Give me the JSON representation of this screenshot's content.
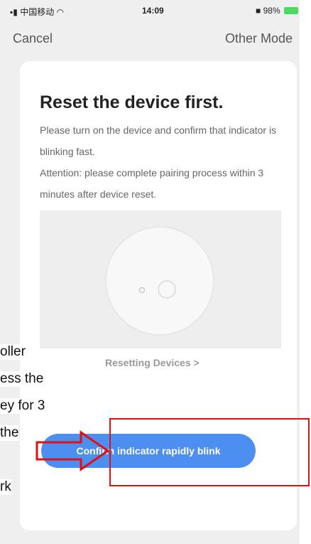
{
  "status_bar": {
    "carrier": "中国移动",
    "time": "14:09",
    "battery": "98%"
  },
  "nav": {
    "cancel_label": "Cancel",
    "other_mode_label": "Other Mode"
  },
  "card": {
    "title": "Reset the device first.",
    "instruction": "Please turn on the device and confirm that indicator is blinking fast.",
    "attention": "Attention: please complete pairing process within 3 minutes after device reset.",
    "reset_link": "Resetting Devices >",
    "confirm_button": "Confirm indicator rapidly blink"
  },
  "overlay_fragments": [
    "oller",
    "ess the",
    "ey for 3",
    "the",
    "rk"
  ],
  "colors": {
    "button": "#4c8ff0",
    "annotation": "#e21010"
  },
  "icons": {
    "wifi": "wifi-icon",
    "battery": "battery-icon",
    "signal": "signal-icon"
  }
}
